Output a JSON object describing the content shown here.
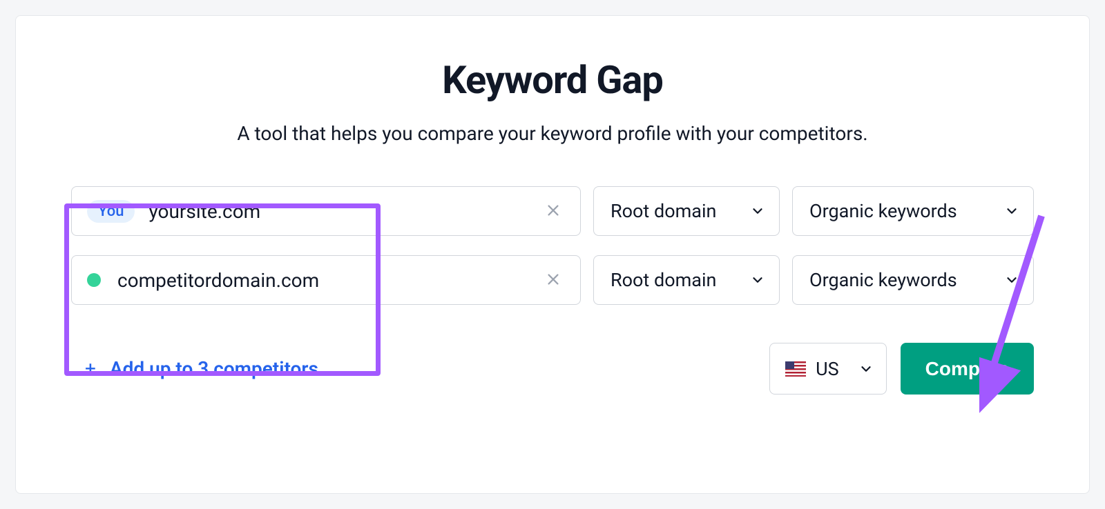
{
  "header": {
    "title": "Keyword Gap",
    "subtitle": "A tool that helps you compare your keyword profile with your competitors."
  },
  "rows": [
    {
      "badge": "You",
      "domain": "yoursite.com",
      "scope": "Root domain",
      "keywords": "Organic keywords"
    },
    {
      "dot_color": "#34d399",
      "domain": "competitordomain.com",
      "scope": "Root domain",
      "keywords": "Organic keywords"
    }
  ],
  "add_competitors_label": "Add up to 3 competitors",
  "country": {
    "code": "US"
  },
  "compare_label": "Compare"
}
